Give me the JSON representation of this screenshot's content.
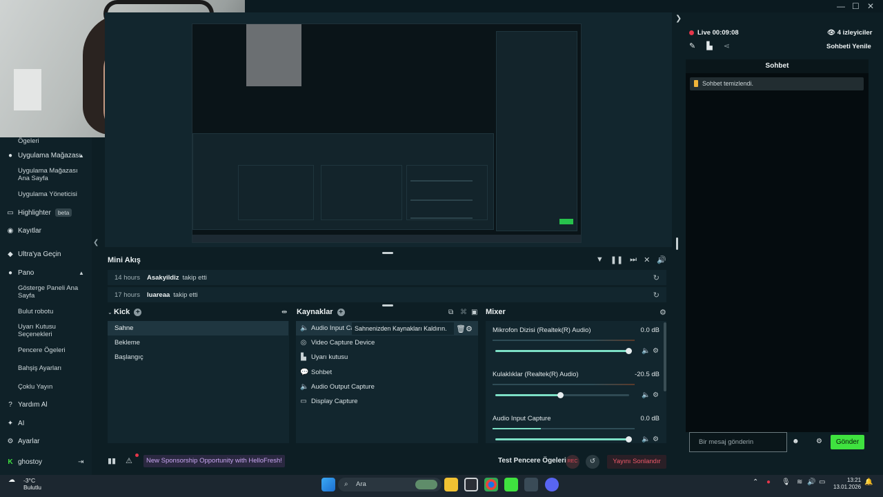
{
  "sidebar": {
    "top_partial": "Ögeleri",
    "items": [
      {
        "label": "Uygulama Mağazası",
        "icon": "palette-icon"
      },
      {
        "label": "Uygulama Mağazası Ana Sayfa"
      },
      {
        "label": "Uygulama Yöneticisi"
      },
      {
        "label": "Highlighter",
        "badge": "beta",
        "icon": "monitor-icon"
      },
      {
        "label": "Kayıtlar",
        "icon": "record-icon"
      },
      {
        "label": "Ultra'ya Geçin",
        "icon": "diamond-icon"
      },
      {
        "label": "Pano",
        "icon": "palette-icon"
      },
      {
        "label": "Gösterge Paneli Ana Sayfa"
      },
      {
        "label": "Bulut robotu"
      },
      {
        "label": "Uyarı Kutusu Seçenekleri"
      },
      {
        "label": "Pencere Ögeleri"
      },
      {
        "label": "Bahşiş Ayarları"
      },
      {
        "label": "Çoklu Yayın"
      },
      {
        "label": "Yardım Al",
        "icon": "help-icon"
      },
      {
        "label": "AI",
        "icon": "sparkle-icon"
      },
      {
        "label": "Ayarlar",
        "icon": "gear-icon"
      }
    ],
    "user": "ghostoy"
  },
  "mini": {
    "title": "Mini Akış",
    "rows": [
      {
        "time": "14 hours",
        "user": "Asakyildiz",
        "action": "takip etti"
      },
      {
        "time": "17 hours",
        "user": "luareaa",
        "action": "takip etti"
      }
    ]
  },
  "scenes": {
    "title": "Kick",
    "items": [
      "Sahne",
      "Bekleme",
      "Başlangıç"
    ]
  },
  "sources": {
    "title": "Kaynaklar",
    "items": [
      {
        "label": "Audio Input Ca",
        "icon": "speaker-icon"
      },
      {
        "label": "Video Capture Device",
        "icon": "webcam-icon"
      },
      {
        "label": "Uyarı kutusu",
        "icon": "alert-box-icon"
      },
      {
        "label": "Sohbet",
        "icon": "chat-icon"
      },
      {
        "label": "Audio Output Capture",
        "icon": "speaker-icon"
      },
      {
        "label": "Display Capture",
        "icon": "display-icon"
      }
    ],
    "tooltip": "Sahnenizden Kaynakları Kaldırın."
  },
  "mixer": {
    "title": "Mixer",
    "channels": [
      {
        "name": "Mikrofon Dizisi (Realtek(R) Audio)",
        "db": "0.0 dB",
        "level": 1.0
      },
      {
        "name": "Kulaklıklar (Realtek(R) Audio)",
        "db": "-20.5 dB",
        "level": 0.49
      },
      {
        "name": "Audio Input Capture",
        "db": "0.0 dB",
        "level": 1.0
      }
    ]
  },
  "bottom": {
    "promo": "New Sponsorship Opportunity with HelloFresh!",
    "test": "Test Pencere Ögeleri",
    "rec": "REC",
    "end": "Yayını Sonlandır"
  },
  "chat": {
    "live": "Live 00:09:08",
    "viewers": "4 izleyiciler",
    "refresh": "Sohbeti Yenile",
    "header": "Sohbet",
    "message": "Sohbet temizlendi.",
    "placeholder": "Bir mesaj gönderin",
    "send": "Gönder"
  },
  "taskbar": {
    "temp": "-3°C",
    "weather": "Bulutlu",
    "search": "Ara",
    "time": "13:21",
    "date": "13.01.2026"
  },
  "colors": {
    "accent": "#3fe23f",
    "live": "#e5364a",
    "promo": "#c9a6f2",
    "end": "#f05a6a"
  }
}
